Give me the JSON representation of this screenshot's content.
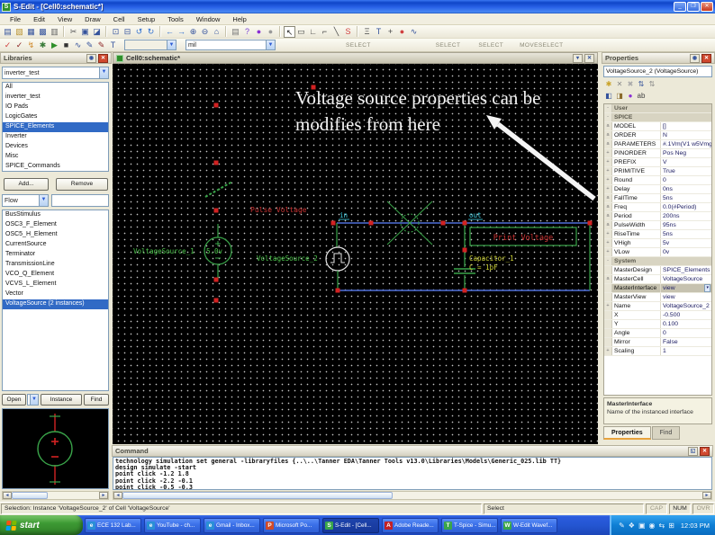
{
  "window": {
    "title": "S-Edit - [Cell0:schematic*]",
    "app_icon": "S",
    "minimize": "_",
    "restore": "❐",
    "close": "✕"
  },
  "menu": {
    "items": [
      "File",
      "Edit",
      "View",
      "Draw",
      "Cell",
      "Setup",
      "Tools",
      "Window",
      "Help"
    ]
  },
  "toolbar1": {
    "icons": [
      {
        "name": "new-design-icon",
        "glyph": "▤"
      },
      {
        "name": "open-design-icon",
        "glyph": "▧",
        "color": "#b8912f"
      },
      {
        "name": "save-icon",
        "glyph": "▦",
        "color": "#35539c"
      },
      {
        "name": "save-design-icon",
        "glyph": "▩",
        "color": "#35539c"
      },
      {
        "name": "print-icon",
        "glyph": "▥",
        "color": "#666666"
      },
      {
        "cls": "sep"
      },
      {
        "name": "cut-icon",
        "glyph": "✂",
        "color": "#555555"
      },
      {
        "name": "copy-icon",
        "glyph": "▣",
        "color": "#35539c"
      },
      {
        "name": "paste-icon",
        "glyph": "◪",
        "color": "#35539c"
      },
      {
        "cls": "sep"
      },
      {
        "name": "zoom-window-icon",
        "glyph": "⊡",
        "color": "#35539c"
      },
      {
        "name": "zoom-previous-icon",
        "glyph": "⊟",
        "color": "#35539c"
      },
      {
        "name": "undo-icon",
        "glyph": "↺",
        "color": "#2f6fd0"
      },
      {
        "name": "redo-icon",
        "glyph": "↻",
        "color": "#2f6fd0"
      },
      {
        "cls": "sep"
      },
      {
        "name": "back-icon",
        "glyph": "←",
        "color": "#2f6fd0"
      },
      {
        "name": "forward-icon",
        "glyph": "→",
        "color": "#2f6fd0"
      },
      {
        "name": "zoom-in-icon",
        "glyph": "⊕",
        "color": "#35539c"
      },
      {
        "name": "zoom-out-icon",
        "glyph": "⊖",
        "color": "#35539c"
      },
      {
        "name": "zoom-fit-icon",
        "glyph": "⌂",
        "color": "#35539c"
      },
      {
        "cls": "sep"
      },
      {
        "name": "print-preview-icon",
        "glyph": "▤",
        "color": "#777777"
      },
      {
        "name": "help-icon",
        "glyph": "?",
        "color": "#7a3fd4"
      },
      {
        "name": "render-sphere-icon",
        "glyph": "●",
        "color": "#8a2fd4"
      },
      {
        "name": "render-sphere2-icon",
        "glyph": "●",
        "color": "#999999"
      },
      {
        "cls": "sep"
      },
      {
        "name": "select-tool-icon",
        "glyph": "↖",
        "cls": "boxed",
        "color": "#222222"
      },
      {
        "name": "box-tool-icon",
        "glyph": "▭",
        "color": "#444444"
      },
      {
        "name": "wire-orthogonal-tool-icon",
        "glyph": "∟",
        "color": "#444444"
      },
      {
        "name": "wire-any-angle-tool-icon",
        "glyph": "⌐",
        "color": "#444444"
      },
      {
        "name": "wire-diagonal-tool-icon",
        "glyph": "╲",
        "color": "#444444"
      },
      {
        "name": "wire-curve-tool-icon",
        "glyph": "S",
        "color": "#d04040"
      },
      {
        "cls": "sep"
      },
      {
        "name": "symbol-tool-icon",
        "glyph": "Ξ",
        "color": "#444444"
      },
      {
        "name": "text-tool-icon",
        "glyph": "T",
        "color": "#35539c"
      },
      {
        "name": "pin-tool-icon",
        "glyph": "+",
        "color": "#444444"
      },
      {
        "name": "dot-tool-icon",
        "glyph": "●",
        "color": "#d04040"
      },
      {
        "name": "annotation-tool-icon",
        "glyph": "∿",
        "color": "#35539c"
      }
    ]
  },
  "toolbar2": {
    "icons": [
      {
        "name": "check-design-icon",
        "glyph": "✓",
        "color": "#d04040"
      },
      {
        "name": "check-connectivity-icon",
        "glyph": "✓",
        "color": "#8a1f1f"
      },
      {
        "name": "highlight-net-icon",
        "glyph": "↯",
        "color": "#d08b2f"
      },
      {
        "name": "setup-simulation-icon",
        "glyph": "✱",
        "color": "#3a7c3a"
      },
      {
        "name": "start-simulation-icon",
        "glyph": "▶",
        "color": "#2f8f2a"
      },
      {
        "name": "stop-simulation-icon",
        "glyph": "■",
        "color": "#333333"
      },
      {
        "name": "waveform-probe-icon",
        "glyph": "∿",
        "color": "#35539c"
      },
      {
        "name": "probe-voltage-icon",
        "glyph": "✎",
        "color": "#35539c"
      },
      {
        "name": "probe-current-icon",
        "glyph": "✎",
        "color": "#8a1f1f"
      },
      {
        "name": "probe-tp-icon",
        "glyph": "T",
        "color": "#35539c"
      }
    ],
    "sim_combo_value": "",
    "cell_combo_value": "mil",
    "hints": [
      "SELECT",
      "SELECT",
      "SELECT",
      "MOVE",
      "SELECT"
    ]
  },
  "libraries": {
    "title": "Libraries",
    "library_combo": "inverter_test",
    "list1": [
      {
        "text": "All"
      },
      {
        "text": "inverter_test"
      },
      {
        "text": "IO Pads"
      },
      {
        "text": "LogicGates"
      },
      {
        "text": "SPICE_Elements",
        "cls": "selected"
      },
      {
        "text": "Inverter"
      },
      {
        "text": "Devices"
      },
      {
        "text": "Misc"
      },
      {
        "text": "SPICE_Commands"
      }
    ],
    "add_button": "Add...",
    "remove_button": "Remove",
    "flow_label": "Flow",
    "filter_value": "",
    "list2": [
      {
        "text": "BusStimulus"
      },
      {
        "text": "OSC3_F_Element"
      },
      {
        "text": "OSC5_H_Element"
      },
      {
        "text": "CurrentSource"
      },
      {
        "text": "Terminator"
      },
      {
        "text": "TransmissionLine"
      },
      {
        "text": "VCO_Q_Element"
      },
      {
        "text": "VCVS_L_Element"
      },
      {
        "text": "Vector"
      },
      {
        "text": "VoltageSource (2 instances)",
        "cls": "selected"
      }
    ],
    "open_button": "Open",
    "instance_button": "Instance",
    "find_button": "Find"
  },
  "schematic": {
    "tab_title": "Cell0:schematic*",
    "annotation": {
      "line1": "Voltage source properties can be",
      "line2": "modifies from here"
    },
    "labels": {
      "vs1_name": "VoltageSource_1",
      "vs1_value": "5.0v",
      "pulse_voltage": "Pulse Voltage",
      "vs2_name": "VoltageSource_2",
      "in_port": "in",
      "out_port": "out",
      "print_voltage": "Print Voltage",
      "cap_name": "Capacitor_1",
      "cap_value": "C = 1pF"
    }
  },
  "properties": {
    "title": "Properties",
    "header": "VoltageSource_2 (VoltageSource)",
    "toolbar1_icons": [
      {
        "name": "add-property-icon",
        "glyph": "✱",
        "color": "#c9a227"
      },
      {
        "name": "delete-property-icon",
        "glyph": "✕",
        "color": "#888888"
      },
      {
        "name": "delete-all-properties-icon",
        "glyph": "✖",
        "color": "#aaaaaa"
      },
      {
        "name": "sort-ascending-icon",
        "glyph": "⇅",
        "color": "#35539c"
      },
      {
        "name": "sort-descending-icon",
        "glyph": "⇅",
        "color": "#888888"
      }
    ],
    "toolbar2_icons": [
      {
        "name": "show-all-properties-icon",
        "glyph": "◧",
        "color": "#35539c"
      },
      {
        "name": "show-set-properties-icon",
        "glyph": "◨",
        "color": "#8a6a2a"
      },
      {
        "name": "evaluate-expressions-icon",
        "glyph": "●",
        "color": "#8a2fd4"
      },
      {
        "name": "text-display-icon",
        "glyph": "ab",
        "color": "#444444"
      }
    ],
    "rows": [
      {
        "cls": "section",
        "gutter": "-",
        "label": "User",
        "value": ""
      },
      {
        "cls": "section",
        "gutter": "-",
        "label": "SPICE",
        "value": ""
      },
      {
        "gutter": "a",
        "label": "MODEL",
        "value": "[]"
      },
      {
        "gutter": "a",
        "label": "ORDER",
        "value": "N"
      },
      {
        "gutter": "a",
        "label": "PARAMETERS",
        "value": "#.1Vm(V1 w5Vmg]"
      },
      {
        "gutter": "+",
        "label": "PINORDER",
        "value": "Pos Neg"
      },
      {
        "gutter": "+",
        "label": "PREFIX",
        "value": "V"
      },
      {
        "gutter": "+",
        "label": "PRIMITIVE",
        "value": "True"
      },
      {
        "gutter": "+",
        "label": "Round",
        "value": "0"
      },
      {
        "gutter": "+",
        "label": "Delay",
        "value": "0ns"
      },
      {
        "gutter": "a",
        "label": "FallTime",
        "value": "5ns"
      },
      {
        "gutter": "a",
        "label": "Freq",
        "value": "0.0(#Period)"
      },
      {
        "gutter": "a",
        "label": "Period",
        "value": "200ns"
      },
      {
        "gutter": "a",
        "label": "PulseWidth",
        "value": "95ns"
      },
      {
        "gutter": "+",
        "label": "RiseTime",
        "value": "5ns"
      },
      {
        "gutter": "+",
        "label": "VHigh",
        "value": "5v"
      },
      {
        "gutter": "+",
        "label": "VLow",
        "value": "0v"
      },
      {
        "cls": "section",
        "gutter": "-",
        "label": "System",
        "value": ""
      },
      {
        "gutter": "",
        "label": "MasterDesign",
        "value": "SPICE_Elements"
      },
      {
        "gutter": "a",
        "label": "MasterCell",
        "value": "VoltageSource"
      },
      {
        "cls": "selected",
        "gutter": "",
        "label": "MasterInterface",
        "value": "view"
      },
      {
        "gutter": "",
        "label": "MasterView",
        "value": "view"
      },
      {
        "gutter": "+",
        "label": "Name",
        "value": "VoltageSource_2"
      },
      {
        "gutter": "",
        "label": "X",
        "value": "-0.500"
      },
      {
        "gutter": "",
        "label": "Y",
        "value": "0.100"
      },
      {
        "gutter": "",
        "label": "Angle",
        "value": "0"
      },
      {
        "gutter": "",
        "label": "Mirror",
        "value": "False"
      },
      {
        "gutter": "+",
        "label": "Scaling",
        "value": "1"
      }
    ],
    "description_title": "MasterInterface",
    "description_text": "Name of the instanced interface",
    "tabs": [
      {
        "text": "Properties",
        "cls": "active",
        "name": "tab-properties"
      },
      {
        "text": "Find",
        "name": "tab-find"
      }
    ]
  },
  "command": {
    "title": "Command",
    "lines": [
      "technology simulation set general -libraryfiles {..\\..\\Tanner EDA\\Tanner Tools v13.0\\Libraries\\Models\\Generic_025.lib TT}",
      "design simulate -start",
      "point click -1.2 1.8",
      "point click -2.2 -0.1",
      "point click -0.5 -0.3"
    ]
  },
  "statusbar": {
    "selection": "Selection: Instance 'VoltageSource_2' of Cell 'VoltageSource'",
    "mode": "Select",
    "cap": "CAP",
    "num": "NUM",
    "ovr": "OVR"
  },
  "taskbar": {
    "start_label": "start",
    "tasks": [
      {
        "name": "task-ece-132-lab",
        "icon": "e",
        "iconbg": "#2a8fd6",
        "label": "ECE 132 Lab..."
      },
      {
        "name": "task-youtube",
        "icon": "e",
        "iconbg": "#2a8fd6",
        "label": "YouTube - ch..."
      },
      {
        "name": "task-gmail",
        "icon": "e",
        "iconbg": "#2a8fd6",
        "label": "Gmail - Inbox..."
      },
      {
        "name": "task-microsoft-powerpoint",
        "icon": "P",
        "iconbg": "#d04a2a",
        "label": "Microsoft Po..."
      },
      {
        "name": "task-s-edit",
        "icon": "S",
        "iconbg": "#3aa54a",
        "label": "S-Edit - [Cell...",
        "cls": "active"
      },
      {
        "name": "task-adobe-reader",
        "icon": "A",
        "iconbg": "#c22026",
        "label": "Adobe Reade..."
      },
      {
        "name": "task-t-spice",
        "icon": "T",
        "iconbg": "#3aa54a",
        "label": "T-Spice - Simu..."
      },
      {
        "name": "task-w-edit",
        "icon": "W",
        "iconbg": "#3aa54a",
        "label": "W-Edit Wavef..."
      }
    ],
    "tray_icons": [
      {
        "name": "tablet-pen-icon",
        "glyph": "✎"
      },
      {
        "name": "messenger-icon",
        "glyph": "❖"
      },
      {
        "name": "task-window-icon",
        "glyph": "▣"
      },
      {
        "name": "volume-icon",
        "glyph": "◉"
      },
      {
        "name": "network-icon",
        "glyph": "⇆"
      },
      {
        "name": "windows-security-icon",
        "glyph": "⊞"
      }
    ],
    "clock": "12:03 PM"
  },
  "colors": {
    "selection_blue": "#316ac5",
    "taskbar_blue": "#2456d2",
    "start_green": "#3d9a34",
    "wire_blue": "#4f6fd8",
    "schematic_green": "#3aa54a",
    "marker_red": "#d22222",
    "label_yellow": "#cfd435",
    "port_cyan": "#3fd4e8",
    "annotation_white": "#f4f4f4"
  }
}
